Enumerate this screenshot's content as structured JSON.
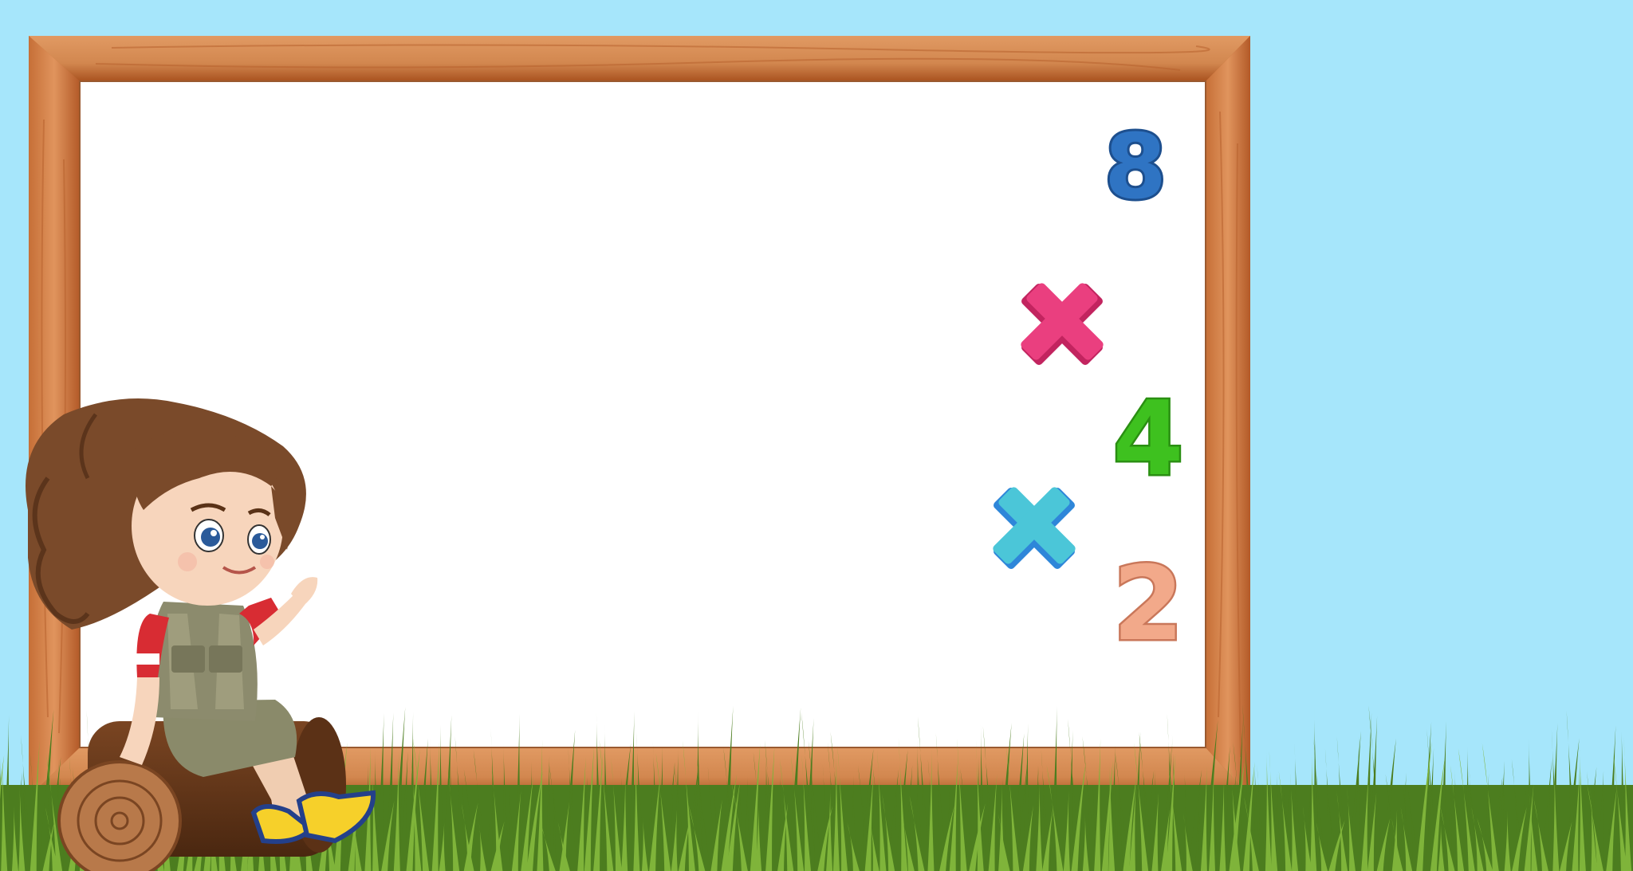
{
  "slide": {
    "background_color": "#a6e6fb",
    "board": {
      "surface_color": "#ffffff",
      "frame_color": "#d2874f",
      "frame_dark_color": "#b35a28"
    },
    "decorations": {
      "digit_top": "8",
      "digit_middle": "4",
      "digit_bottom": "2",
      "operator_top": "multiply-sign-pink",
      "operator_bottom": "multiply-sign-cyan",
      "character": "girl-sitting-on-log",
      "ground": "grass"
    },
    "colors": {
      "digit_8": "#2f74c3",
      "digit_4": "#3ec11f",
      "digit_2": "#f2a98a",
      "cross_pink": "#ea3f7f",
      "cross_cyan": "#4bc6d8",
      "grass_light": "#7fb43a",
      "grass_dark": "#4c7d1f"
    }
  }
}
